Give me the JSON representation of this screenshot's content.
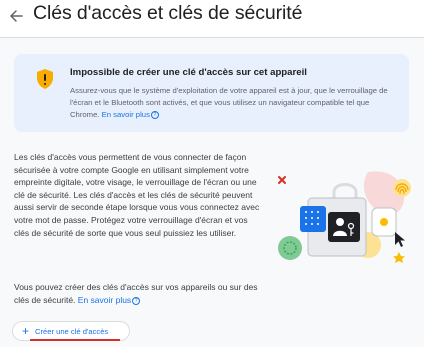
{
  "header": {
    "title": "Clés d'accès et clés de sécurité"
  },
  "warning": {
    "title": "Impossible de créer une clé d'accès sur cet appareil",
    "text": "Assurez-vous que le système d'exploitation de votre appareil est à jour, que le verrouillage de l'écran et le Bluetooth sont activés, et que vous utilisez un navigateur compatible tel que Chrome.",
    "link": "En savoir plus",
    "icon": "shield-warning-icon",
    "accent_color": "#f9ab00"
  },
  "main": {
    "description": "Les clés d'accès vous permettent de vous connecter de façon sécurisée à votre compte Google en utilisant simplement votre empreinte digitale, votre visage, le verrouillage de l'écran ou une clé de sécurité. Les clés d'accès et les clés de sécurité peuvent aussi servir de seconde étape lorsque vous vous connectez avec votre mot de passe. Protégez votre verrouillage d'écran et vos clés de sécurité de sorte que vous seul puissiez les utiliser.",
    "secondary": "Vous pouvez créer des clés d'accès sur vos appareils ou sur des clés de sécurité.",
    "secondary_link": "En savoir plus",
    "create_button": "Créer une clé d'accès"
  },
  "colors": {
    "link": "#1a73e8",
    "card_bg": "#e8f0fe",
    "highlight": "#d93025"
  }
}
